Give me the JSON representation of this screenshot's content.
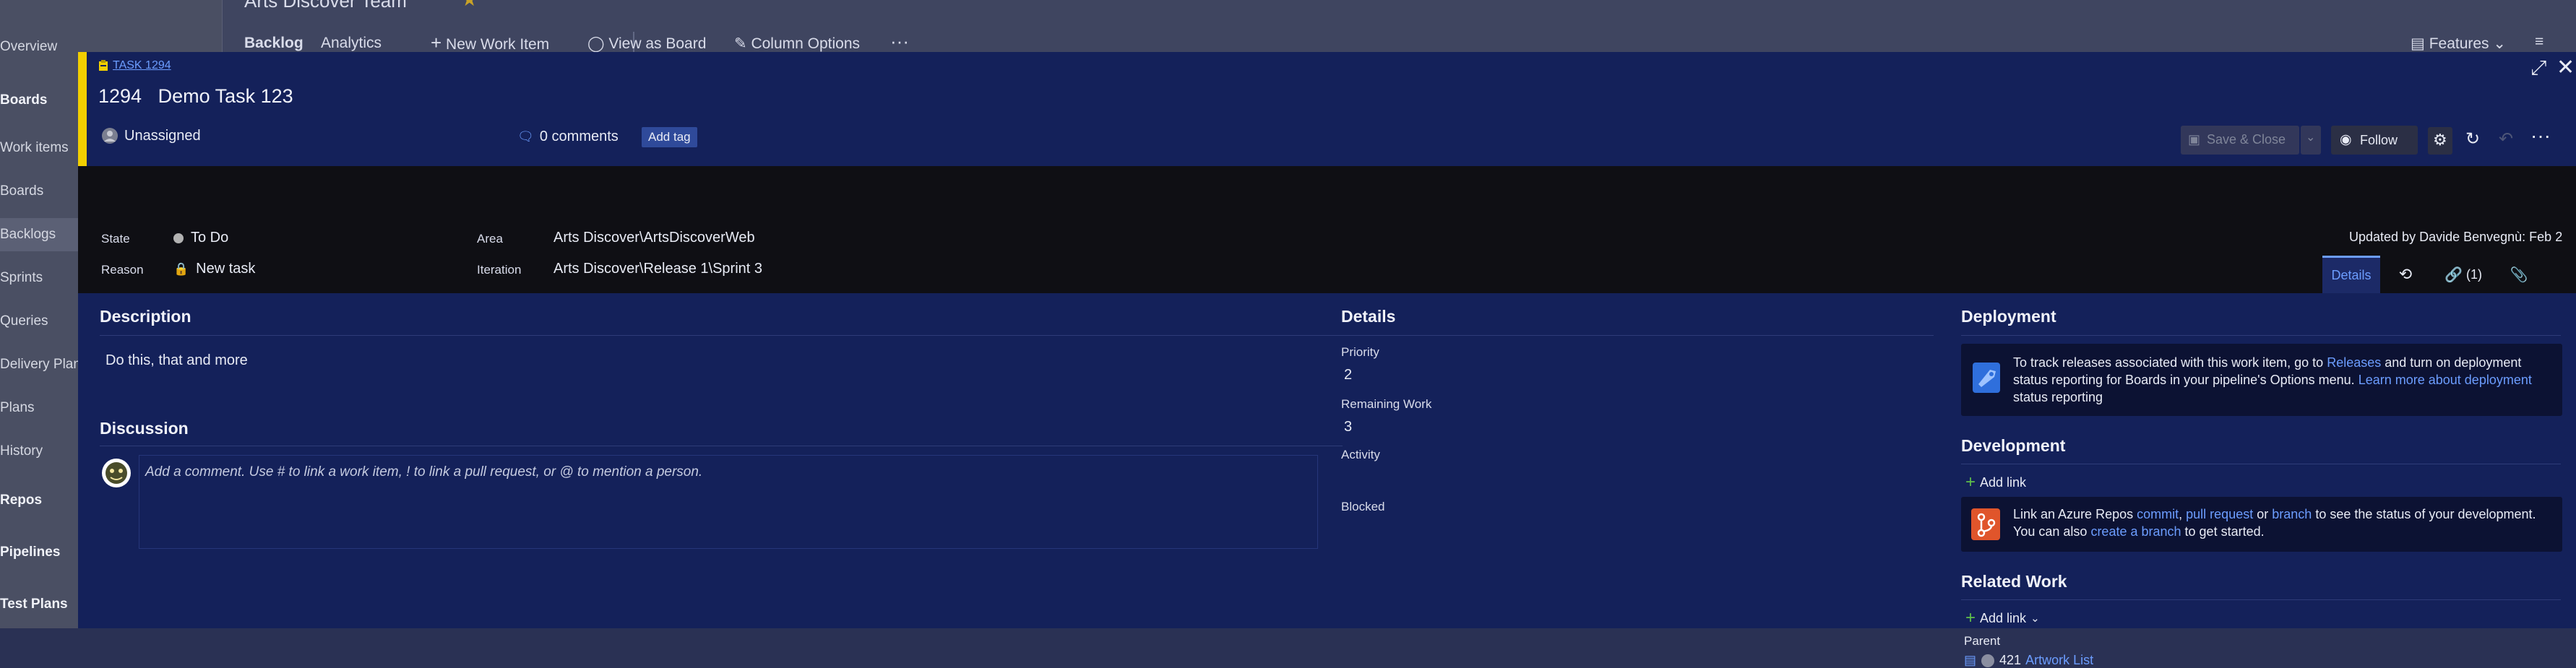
{
  "background": {
    "nav_items": [
      "Overview",
      "Boards",
      "Work items",
      "Boards",
      "Backlogs",
      "Sprints",
      "Queries",
      "Delivery Plans",
      "Plans",
      "History",
      "Repos",
      "Pipelines",
      "Test Plans"
    ],
    "team_title": "Arts Discover Team",
    "tabs": [
      "Backlog",
      "Analytics"
    ],
    "actions": [
      "New Work Item",
      "View as Board",
      "Column Options"
    ],
    "features_label": "Features"
  },
  "dialog": {
    "type_label": "TASK 1294",
    "id": "1294",
    "title": "Demo Task 123",
    "assignee": "Unassigned",
    "comments": "0 comments",
    "add_tag": "Add tag",
    "save_close": "Save & Close",
    "follow": "Follow",
    "updated_by": "Updated by Davide Benvegnù: Feb 2",
    "fields": {
      "state_label": "State",
      "state_value": "To Do",
      "reason_label": "Reason",
      "reason_value": "New task",
      "area_label": "Area",
      "area_value": "Arts Discover\\ArtsDiscoverWeb",
      "iteration_label": "Iteration",
      "iteration_value": "Arts Discover\\Release 1\\Sprint 3"
    },
    "tabs": {
      "details": "Details",
      "links": "(1)"
    },
    "description": {
      "title": "Description",
      "text": "Do this, that and more"
    },
    "discussion": {
      "title": "Discussion",
      "placeholder": "Add a comment. Use # to link a work item, ! to link a pull request, or @ to mention a person."
    },
    "details": {
      "title": "Details",
      "priority_label": "Priority",
      "priority_value": "2",
      "remaining_label": "Remaining Work",
      "remaining_value": "3",
      "activity_label": "Activity",
      "blocked_label": "Blocked"
    },
    "deployment": {
      "title": "Deployment",
      "t1": "To track releases associated with this work item, go to",
      "releases_link": "Releases",
      "t2": "and turn on deployment",
      "t3": "status reporting for Boards in your pipeline's Options menu.",
      "learn_link_a": "Learn more about deployment",
      "learn_link_b": "status reporting"
    },
    "development": {
      "title": "Development",
      "add_link": "Add link",
      "t1": "Link an Azure Repos",
      "commit": "commit",
      "comma": ",",
      "pull_request": "pull request",
      "or": "or",
      "branch": "branch",
      "t2": "to see the status of your development.",
      "t3": "You can also",
      "create_branch": "create a branch",
      "t4": "to get started."
    },
    "related": {
      "title": "Related Work",
      "add_link": "Add link",
      "parent_label": "Parent",
      "parent_id": "421",
      "parent_title": "Artwork List"
    }
  },
  "colors": {
    "accent": "#f2cf00",
    "link": "#6c9dff",
    "dialog_bg": "#14215a"
  }
}
